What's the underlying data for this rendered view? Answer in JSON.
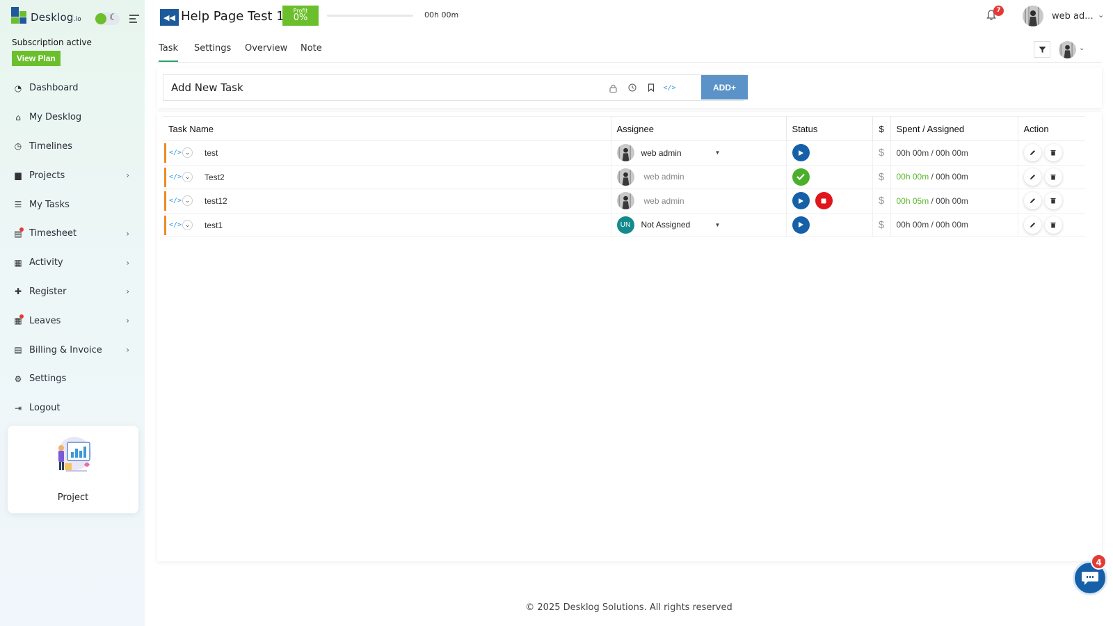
{
  "app": {
    "logo_text": "Desklog",
    "logo_suffix": ".io",
    "subscription_text": "Subscription active",
    "view_plan_label": "View Plan"
  },
  "sidebar": {
    "items": [
      {
        "label": "Dashboard",
        "icon": "dashboard-icon",
        "has_submenu": false
      },
      {
        "label": "My Desklog",
        "icon": "home-icon",
        "has_submenu": false
      },
      {
        "label": "Timelines",
        "icon": "clock-icon",
        "has_submenu": false
      },
      {
        "label": "Projects",
        "icon": "book-icon",
        "has_submenu": true
      },
      {
        "label": "My Tasks",
        "icon": "tasks-icon",
        "has_submenu": false
      },
      {
        "label": "Timesheet",
        "icon": "timesheet-icon",
        "has_submenu": true,
        "notification": true
      },
      {
        "label": "Activity",
        "icon": "grid-icon",
        "has_submenu": true
      },
      {
        "label": "Register",
        "icon": "plus-icon",
        "has_submenu": true
      },
      {
        "label": "Leaves",
        "icon": "calendar-icon",
        "has_submenu": true,
        "notification": true
      },
      {
        "label": "Billing & Invoice",
        "icon": "invoice-icon",
        "has_submenu": true
      },
      {
        "label": "Settings",
        "icon": "gear-icon",
        "has_submenu": false
      },
      {
        "label": "Logout",
        "icon": "logout-icon",
        "has_submenu": false
      }
    ],
    "promo_label": "Project"
  },
  "header": {
    "project_title": "Help Page Test 1",
    "profit_label": "Profit",
    "profit_value": "0%",
    "progress_fraction": 0.0,
    "time_text": "00h 00m",
    "notification_count": "7",
    "user_name": "web ad..."
  },
  "tabs": [
    {
      "label": "Task",
      "active": true
    },
    {
      "label": "Settings",
      "active": false
    },
    {
      "label": "Overview",
      "active": false
    },
    {
      "label": "Note",
      "active": false
    }
  ],
  "add_task": {
    "placeholder": "Add New Task",
    "add_label": "ADD+"
  },
  "table": {
    "headers": [
      "Task Name",
      "Assignee",
      "Status",
      "$",
      "Spent / Assigned",
      "Action"
    ],
    "rows": [
      {
        "name": "test",
        "assignee": "web admin",
        "assignee_type": "avatar-dropdown",
        "status": [
          "play"
        ],
        "currency": "$",
        "spent": "00h 00m",
        "separator": " / ",
        "assigned": "00h 00m",
        "spent_highlight": false
      },
      {
        "name": "Test2",
        "assignee": "web admin",
        "assignee_type": "avatar-muted",
        "status": [
          "check"
        ],
        "currency": "$",
        "spent": "00h 00m",
        "separator": " / ",
        "assigned": "00h 00m",
        "spent_highlight": true
      },
      {
        "name": "test12",
        "assignee": "web admin",
        "assignee_type": "avatar-muted",
        "status": [
          "play",
          "stop"
        ],
        "currency": "$",
        "spent": "00h 05m",
        "separator": " / ",
        "assigned": "00h 00m",
        "spent_highlight": true
      },
      {
        "name": "test1",
        "assignee": "Not Assigned",
        "assignee_initials": "UN",
        "assignee_type": "initials-dropdown",
        "status": [
          "play"
        ],
        "currency": "$",
        "spent": "00h 00m",
        "separator": " / ",
        "assigned": "00h 00m",
        "spent_highlight": false
      }
    ]
  },
  "footer": {
    "copyright": "© 2025 Desklog Solutions. All rights reserved"
  },
  "chat": {
    "badge_count": "4"
  },
  "colors": {
    "brand_green": "#6bbf2c",
    "brand_blue": "#1660a8",
    "accent_orange": "#f08a24",
    "danger_red": "#e0161c"
  }
}
